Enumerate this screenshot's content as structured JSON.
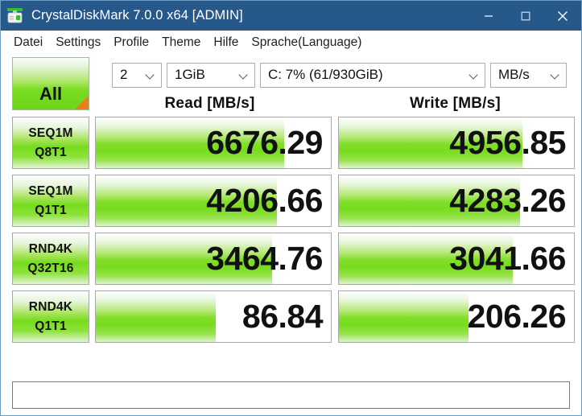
{
  "window": {
    "title": "CrystalDiskMark 7.0.0 x64 [ADMIN]",
    "icon": "disk-drive-icon",
    "titlebar_color": "#27588a",
    "accent_green": "#78dc1e",
    "accent_orange": "#f07c1d",
    "controls": {
      "minimize": "minimize-icon",
      "maximize": "maximize-icon",
      "close": "close-icon"
    }
  },
  "menubar": {
    "items": [
      {
        "label": "Datei"
      },
      {
        "label": "Settings"
      },
      {
        "label": "Profile"
      },
      {
        "label": "Theme"
      },
      {
        "label": "Hilfe"
      },
      {
        "label": "Sprache(Language)"
      }
    ]
  },
  "toolbar": {
    "all_button": "All",
    "count": {
      "value": "2"
    },
    "size": {
      "value": "1GiB"
    },
    "drive": {
      "value": "C: 7% (61/930GiB)"
    },
    "unit": {
      "value": "MB/s"
    }
  },
  "columns": {
    "read": "Read [MB/s]",
    "write": "Write [MB/s]"
  },
  "chart_data": {
    "type": "bar",
    "title": "CrystalDiskMark 7.0.0 x64 [ADMIN]",
    "xlabel": "",
    "ylabel": "MB/s",
    "categories": [
      "SEQ1M Q8T1",
      "SEQ1M Q1T1",
      "RND4K Q32T16",
      "RND4K Q1T1"
    ],
    "series": [
      {
        "name": "Read [MB/s]",
        "values": [
          6676.29,
          4206.66,
          3464.76,
          86.84
        ]
      },
      {
        "name": "Write [MB/s]",
        "values": [
          4956.85,
          4283.26,
          3041.66,
          206.26
        ]
      }
    ],
    "legend_position": "top",
    "grid": false
  },
  "rows": [
    {
      "label_top": "SEQ1M",
      "label_bottom": "Q8T1",
      "read": {
        "value": "6676.29",
        "fill_pct": 80
      },
      "write": {
        "value": "4956.85",
        "fill_pct": 78
      }
    },
    {
      "label_top": "SEQ1M",
      "label_bottom": "Q1T1",
      "read": {
        "value": "4206.66",
        "fill_pct": 77
      },
      "write": {
        "value": "4283.26",
        "fill_pct": 77
      }
    },
    {
      "label_top": "RND4K",
      "label_bottom": "Q32T16",
      "read": {
        "value": "3464.76",
        "fill_pct": 75
      },
      "write": {
        "value": "3041.66",
        "fill_pct": 74
      }
    },
    {
      "label_top": "RND4K",
      "label_bottom": "Q1T1",
      "read": {
        "value": "86.84",
        "fill_pct": 51
      },
      "write": {
        "value": "206.26",
        "fill_pct": 55
      }
    }
  ],
  "comment": {
    "value": "",
    "placeholder": ""
  }
}
